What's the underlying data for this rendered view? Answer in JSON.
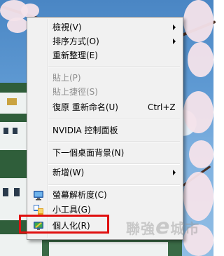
{
  "context_menu": {
    "items": [
      {
        "label": "檢視(V)",
        "has_submenu": true
      },
      {
        "label": "排序方式(O)",
        "has_submenu": true
      },
      {
        "label": "重新整理(E)"
      },
      {
        "label": "貼上(P)",
        "disabled": true
      },
      {
        "label": "貼上捷徑(S)",
        "disabled": true
      },
      {
        "label": "復原 重新命名(U)",
        "shortcut": "Ctrl+Z"
      },
      {
        "label": "NVIDIA 控制面板"
      },
      {
        "label": "下一個桌面背景(N)"
      },
      {
        "label": "新增(W)",
        "has_submenu": true
      },
      {
        "label": "螢幕解析度(C)",
        "icon": "monitor-icon"
      },
      {
        "label": "小工具(G)",
        "icon": "gadgets-icon"
      },
      {
        "label": "個人化(R)",
        "icon": "personalize-icon"
      }
    ]
  },
  "watermark": {
    "text_prefix": "聯強",
    "text_e": "e",
    "text_suffix": "城市"
  },
  "colors": {
    "highlight_box": "#e01010",
    "menu_bg": "#f1f1f1"
  }
}
